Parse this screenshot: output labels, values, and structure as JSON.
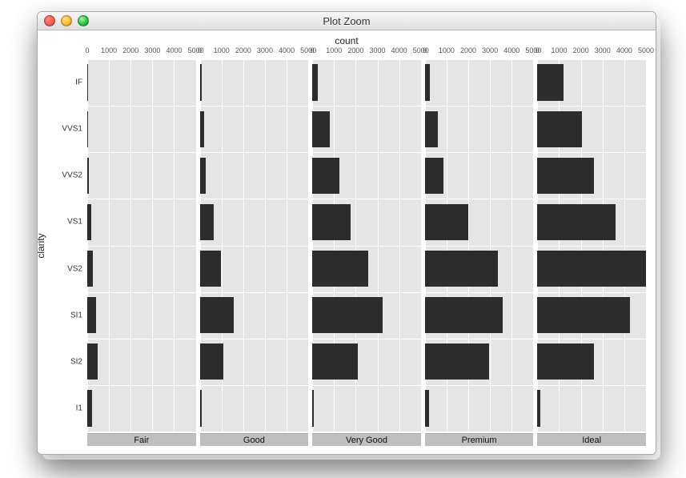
{
  "window": {
    "title": "Plot Zoom"
  },
  "chart_data": {
    "type": "bar",
    "orientation": "horizontal",
    "facet_by": "cut",
    "xlabel": "count",
    "ylabel": "clarity",
    "xlim": [
      0,
      5000
    ],
    "xticks": [
      0,
      1000,
      2000,
      3000,
      4000,
      5000
    ],
    "categories": [
      "IF",
      "VVS1",
      "VVS2",
      "VS1",
      "VS2",
      "SI1",
      "SI2",
      "I1"
    ],
    "facets": [
      "Fair",
      "Good",
      "Very Good",
      "Premium",
      "Ideal"
    ],
    "series": [
      {
        "name": "Fair",
        "values": [
          9,
          17,
          69,
          170,
          261,
          408,
          466,
          210
        ]
      },
      {
        "name": "Good",
        "values": [
          71,
          186,
          286,
          648,
          978,
          1560,
          1081,
          96
        ]
      },
      {
        "name": "Very Good",
        "values": [
          268,
          789,
          1235,
          1775,
          2591,
          3240,
          2100,
          84
        ]
      },
      {
        "name": "Premium",
        "values": [
          230,
          616,
          870,
          1989,
          3357,
          3575,
          2949,
          205
        ]
      },
      {
        "name": "Ideal",
        "values": [
          1212,
          2047,
          2606,
          3589,
          5071,
          4282,
          2598,
          146
        ]
      }
    ],
    "grid": true,
    "legend": false
  }
}
